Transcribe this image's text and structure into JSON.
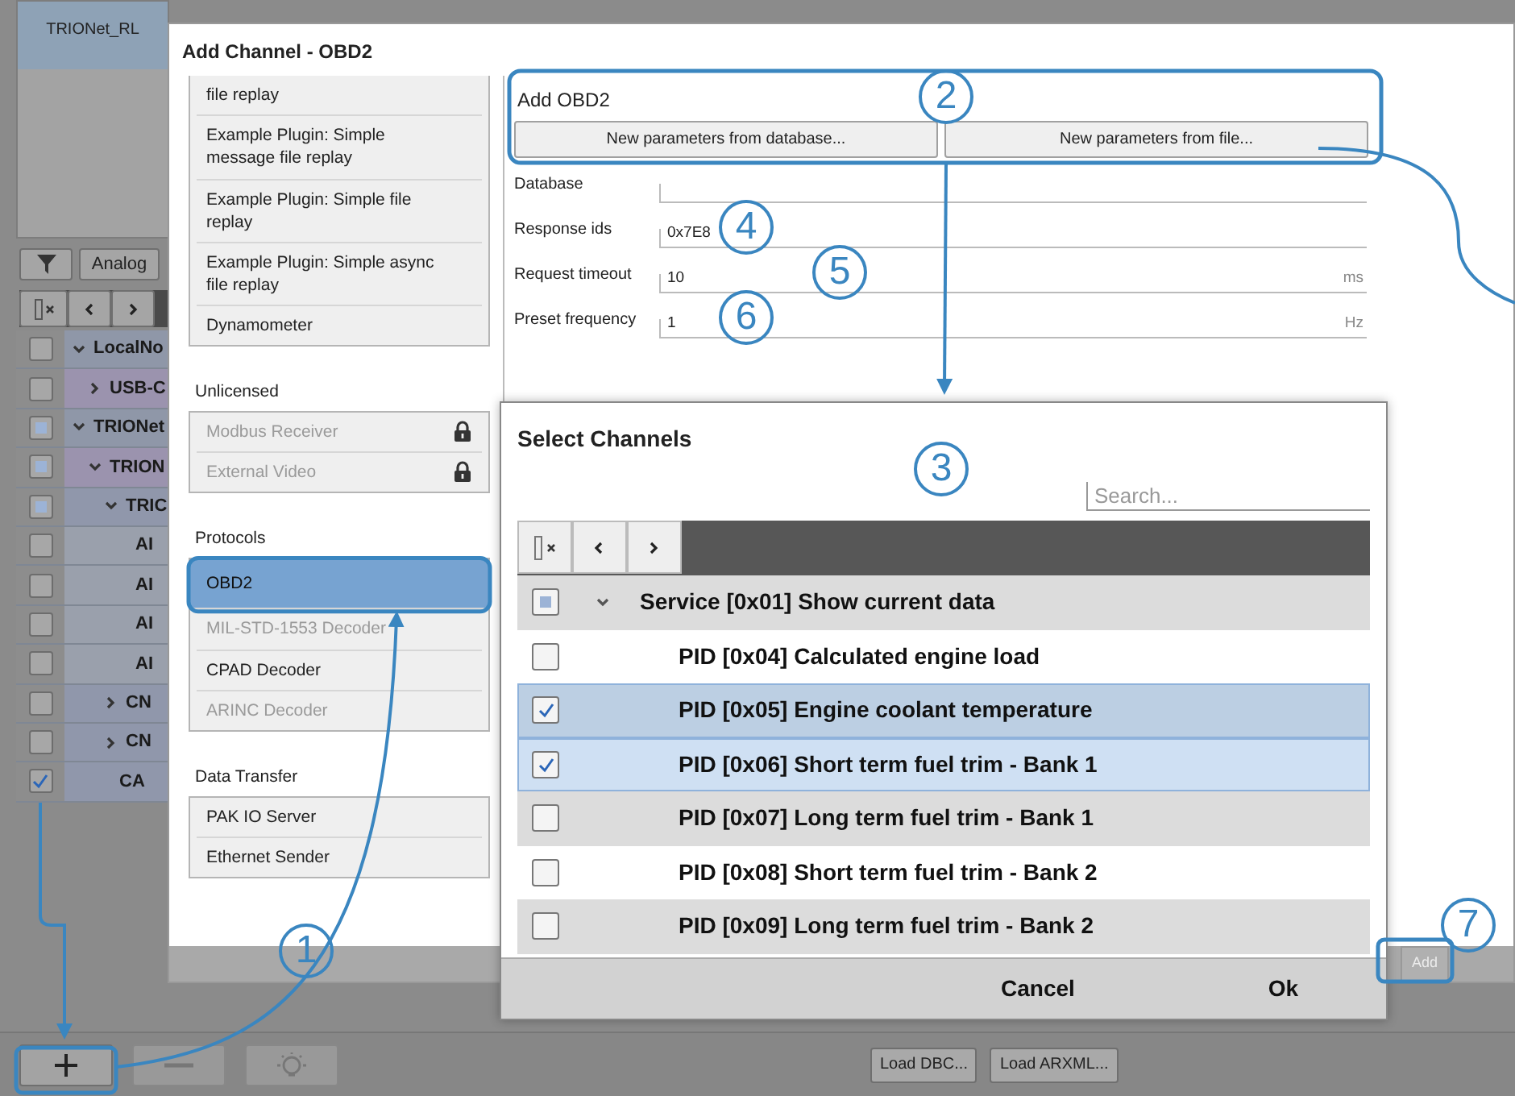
{
  "background_app": {
    "device_tile": "TRIONet_RL",
    "analog_button": "Analog",
    "tree": [
      {
        "label": "LocalNo",
        "checked": false,
        "partial": false,
        "expanded": true,
        "children": [
          {
            "label": "USB-C",
            "checked": false,
            "partial": false,
            "expanded": false
          }
        ]
      },
      {
        "label": "TRIONet",
        "checked": false,
        "partial": true,
        "expanded": true,
        "children": [
          {
            "label": "TRION",
            "checked": false,
            "partial": true,
            "expanded": true,
            "children": [
              {
                "label": "TRIC",
                "checked": false,
                "partial": true,
                "expanded": true,
                "children": [
                  {
                    "label": "AI",
                    "checked": false,
                    "partial": false
                  },
                  {
                    "label": "AI",
                    "checked": false,
                    "partial": false
                  },
                  {
                    "label": "AI",
                    "checked": false,
                    "partial": false
                  },
                  {
                    "label": "AI",
                    "checked": false,
                    "partial": false
                  }
                ]
              },
              {
                "label": "CN",
                "checked": false,
                "partial": false,
                "expanded": false
              },
              {
                "label": "CN",
                "checked": false,
                "partial": false,
                "expanded": false
              },
              {
                "label": "CA",
                "checked": true,
                "partial": false
              }
            ]
          }
        ]
      }
    ],
    "bottom_buttons": [
      "Load DBC...",
      "Load ARXML..."
    ]
  },
  "add_channel_dialog": {
    "title": "Add Channel - OBD2",
    "groups": [
      {
        "items": [
          {
            "label": "file replay",
            "selected": false,
            "disabled": false
          },
          {
            "label": "Example Plugin: Simple message file replay",
            "selected": false,
            "disabled": false
          },
          {
            "label": "Example Plugin: Simple file replay",
            "selected": false,
            "disabled": false
          },
          {
            "label": "Example Plugin: Simple async file replay",
            "selected": false,
            "disabled": false
          },
          {
            "label": "Dynamometer",
            "selected": false,
            "disabled": false
          }
        ]
      },
      {
        "heading": "Unlicensed",
        "items": [
          {
            "label": "Modbus Receiver",
            "selected": false,
            "disabled": true,
            "locked": true
          },
          {
            "label": "External Video",
            "selected": false,
            "disabled": true,
            "locked": true
          }
        ]
      },
      {
        "heading": "Protocols",
        "items": [
          {
            "label": "OBD2",
            "selected": true,
            "disabled": false
          },
          {
            "label": "MIL-STD-1553 Decoder",
            "selected": false,
            "disabled": true
          },
          {
            "label": "CPAD Decoder",
            "selected": false,
            "disabled": false
          },
          {
            "label": "ARINC Decoder",
            "selected": false,
            "disabled": true
          }
        ]
      },
      {
        "heading": "Data Transfer",
        "items": [
          {
            "label": "PAK IO Server",
            "selected": false,
            "disabled": false
          },
          {
            "label": "Ethernet Sender",
            "selected": false,
            "disabled": false
          }
        ]
      }
    ],
    "form": {
      "heading": "Add OBD2",
      "buttons": [
        "New parameters from database...",
        "New parameters from file..."
      ],
      "fields": [
        {
          "label": "Database"
        },
        {
          "label": "Response ids",
          "value": "0x7E8"
        },
        {
          "label": "Request timeout",
          "value": "10",
          "unit": "ms"
        },
        {
          "label": "Preset frequency",
          "value": "1",
          "unit": "Hz"
        }
      ]
    },
    "add_button": {
      "label": "Add",
      "disabled": true
    }
  },
  "select_channels_dialog": {
    "title": "Select Channels",
    "search": {
      "placeholder": "Search..."
    },
    "rows": [
      {
        "kind": "group",
        "label": "Service [0x01] Show current data",
        "checked": false,
        "partial": true,
        "expanded": true,
        "selected": false
      },
      {
        "kind": "item",
        "label": "PID [0x04] Calculated engine load",
        "checked": false,
        "partial": false,
        "selected": false
      },
      {
        "kind": "item",
        "label": "PID [0x05] Engine coolant temperature",
        "checked": true,
        "partial": false,
        "selected": true
      },
      {
        "kind": "item",
        "label": "PID [0x06] Short term fuel trim - Bank 1",
        "checked": true,
        "partial": false,
        "selected": true
      },
      {
        "kind": "item",
        "label": "PID [0x07] Long term fuel trim - Bank 1",
        "checked": false,
        "partial": false,
        "selected": false
      },
      {
        "kind": "item",
        "label": "PID [0x08] Short term fuel trim - Bank 2",
        "checked": false,
        "partial": false,
        "selected": false
      },
      {
        "kind": "item",
        "label": "PID [0x09] Long term fuel trim - Bank 2",
        "checked": false,
        "partial": false,
        "selected": false
      }
    ],
    "buttons": [
      "Cancel",
      "Ok"
    ]
  },
  "callouts": [
    {
      "number": "1"
    },
    {
      "number": "2"
    },
    {
      "number": "3"
    },
    {
      "number": "4"
    },
    {
      "number": "5"
    },
    {
      "number": "6"
    },
    {
      "number": "7"
    }
  ]
}
